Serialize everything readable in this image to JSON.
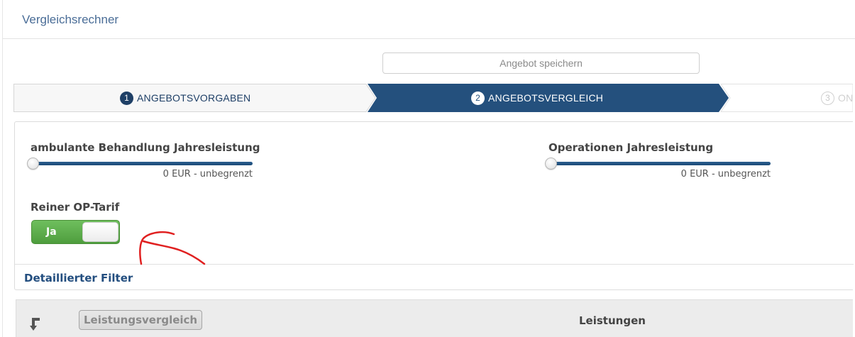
{
  "header": {
    "title": "Vergleichsrechner"
  },
  "toolbar": {
    "save_label": "Angebot speichern"
  },
  "wizard": {
    "steps": [
      {
        "num": "1",
        "label": "ANGEBOTSVORGABEN",
        "state": "done"
      },
      {
        "num": "2",
        "label": "ANGEBOTSVERGLEICH",
        "state": "active"
      },
      {
        "num": "3",
        "label": "ON",
        "state": "upcoming"
      }
    ]
  },
  "filters": {
    "ambulant": {
      "label": "ambulante Behandlung Jahresleistung",
      "value_text": "0 EUR - unbegrenzt",
      "level": 0
    },
    "operationen": {
      "label": "Operationen Jahresleistung",
      "value_text": "0 EUR - unbegrenzt",
      "level": 0
    },
    "op_tarif": {
      "label": "Reiner OP-Tarif",
      "toggle_text": "Ja",
      "checked": true
    },
    "detail_link": "Detaillierter Filter"
  },
  "results_bar": {
    "compare_button": "Leistungsvergleich",
    "column_title": "Leistungen"
  },
  "colors": {
    "primary": "#1e3f66",
    "active_step": "#24507d",
    "toggle_green": "#5cad4a",
    "annotation": "#e02020"
  }
}
